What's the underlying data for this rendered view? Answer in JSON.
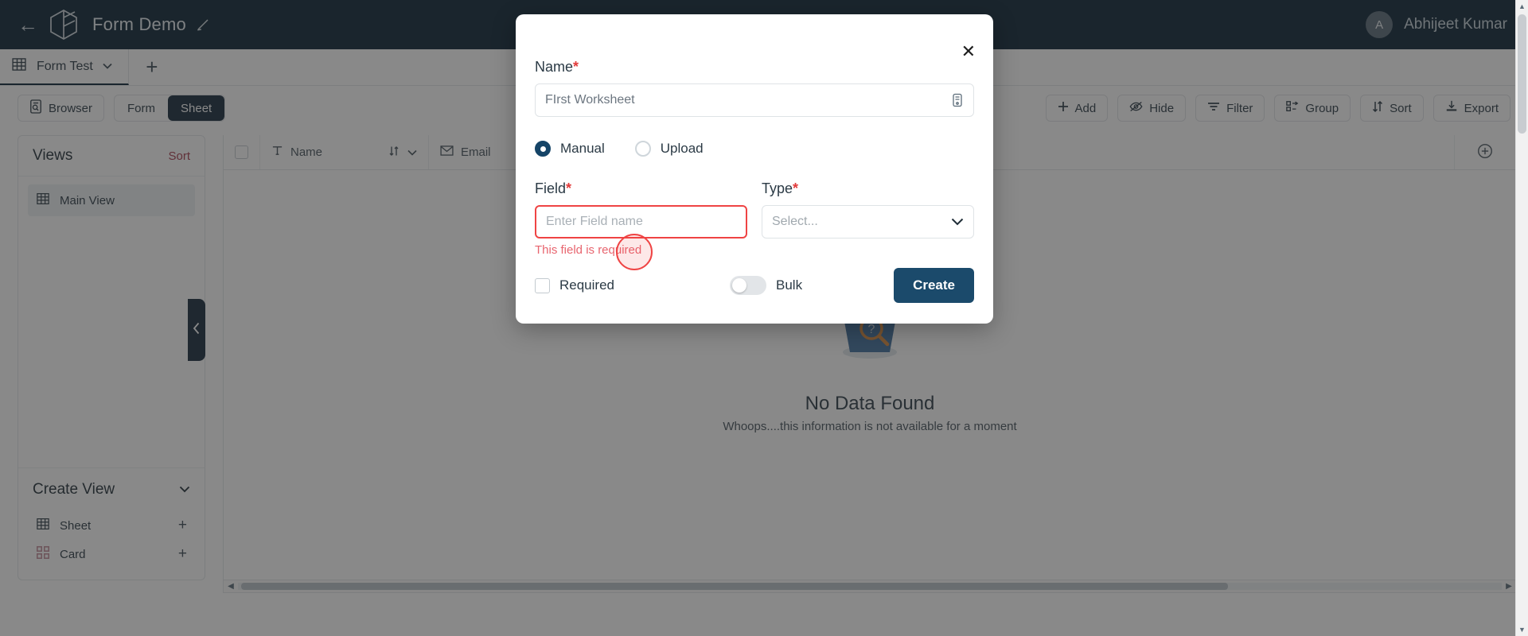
{
  "topbar": {
    "back_icon": "arrow-left-icon",
    "logo_icon": "cube-logo-icon",
    "title": "Form Demo",
    "edit_icon": "pencil-icon",
    "user": {
      "initial": "A",
      "name": "Abhijeet Kumar"
    }
  },
  "tabs": {
    "sheet_icon": "grid-icon",
    "active_tab": "Form Test",
    "caret": "⌄",
    "add_label": "+"
  },
  "toolbar": {
    "browser": {
      "label": "Browser",
      "icon": "document-search-icon"
    },
    "segmented": {
      "form": "Form",
      "sheet": "Sheet",
      "active": "Sheet"
    },
    "actions": [
      {
        "label": "Add",
        "icon": "plus-icon"
      },
      {
        "label": "Hide",
        "icon": "eye-off-icon"
      },
      {
        "label": "Filter",
        "icon": "filter-icon"
      },
      {
        "label": "Group",
        "icon": "group-icon"
      },
      {
        "label": "Sort",
        "icon": "sort-icon"
      },
      {
        "label": "Export",
        "icon": "download-icon"
      }
    ]
  },
  "sidebar": {
    "header": {
      "title": "Views",
      "sort_label": "Sort"
    },
    "views": [
      {
        "label": "Main View",
        "icon": "grid-icon",
        "selected": true
      }
    ],
    "create": {
      "title": "Create View",
      "caret": "⌄",
      "items": [
        {
          "label": "Sheet",
          "icon": "grid-icon",
          "add": "+"
        },
        {
          "label": "Card",
          "icon": "cards-icon",
          "add": "+"
        }
      ]
    },
    "collapse_icon": "chevron-left-icon"
  },
  "grid": {
    "columns": [
      {
        "label": "Name",
        "icon": "text-type-icon",
        "sort_icon": "sort-arrows-icon",
        "menu_icon": "chevron-down-icon"
      },
      {
        "label": "Email",
        "icon": "email-icon"
      }
    ],
    "add_column_icon": "plus-circle-icon",
    "empty": {
      "icon": "no-data-search-icon",
      "title": "No Data Found",
      "subtitle": "Whoops....this information is not available for a moment"
    },
    "scroll_left_icon": "caret-left-icon",
    "scroll_right_icon": "caret-right-icon"
  },
  "modal": {
    "close_icon": "close-icon",
    "name": {
      "label": "Name",
      "required_mark": "*",
      "value": "FIrst Worksheet",
      "placeholder": "FIrst Worksheet",
      "trailing_icon": "copy-icon"
    },
    "source": {
      "options": [
        {
          "label": "Manual",
          "selected": true
        },
        {
          "label": "Upload",
          "selected": false
        }
      ]
    },
    "field": {
      "label": "Field",
      "required_mark": "*",
      "placeholder": "Enter Field name",
      "value": "",
      "error": "This field is required"
    },
    "type": {
      "label": "Type",
      "required_mark": "*",
      "placeholder": "Select...",
      "caret": "⌄"
    },
    "required_checkbox": {
      "label": "Required",
      "checked": false
    },
    "bulk_toggle": {
      "label": "Bulk",
      "on": false
    },
    "submit": {
      "label": "Create"
    }
  },
  "colors": {
    "brand_dark": "#0a2233",
    "accent_blue": "#1b4a6b",
    "error_red": "#ef4444",
    "sort_link": "#a63c4e"
  }
}
